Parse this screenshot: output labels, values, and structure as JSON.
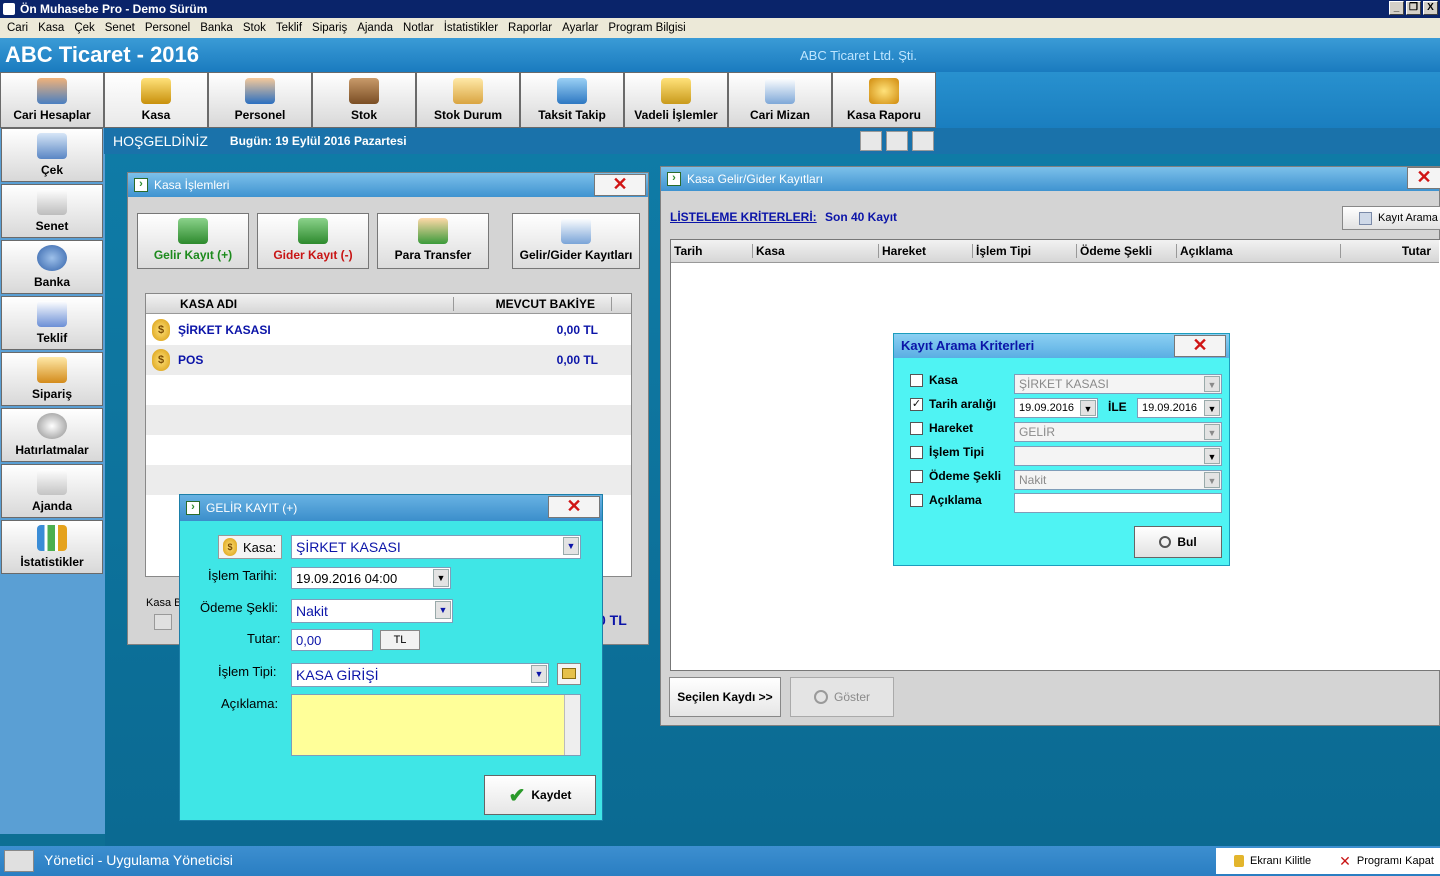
{
  "window": {
    "title": "Ön Muhasebe Pro - Demo Sürüm",
    "buttons": [
      "_",
      "❐",
      "X"
    ]
  },
  "menu": [
    "Cari",
    "Kasa",
    "Çek",
    "Senet",
    "Personel",
    "Banka",
    "Stok",
    "Teklif",
    "Sipariş",
    "Ajanda",
    "Notlar",
    "İstatistikler",
    "Raporlar",
    "Ayarlar",
    "Program Bilgisi"
  ],
  "header": {
    "title": "ABC Ticaret - 2016",
    "company": "ABC Ticaret Ltd. Şti."
  },
  "toolbar": [
    "Cari Hesaplar",
    "Kasa",
    "Personel",
    "Stok",
    "Stok Durum",
    "Taksit Takip",
    "Vadeli İşlemler",
    "Cari Mizan",
    "Kasa Raporu"
  ],
  "welcome": {
    "greeting": "HOŞGELDİNİZ",
    "date": "Bugün: 19 Eylül 2016 Pazartesi"
  },
  "sidebar": [
    "Çek",
    "Senet",
    "Banka",
    "Teklif",
    "Sipariş",
    "Hatırlatmalar",
    "Ajanda",
    "İstatistikler"
  ],
  "kasa_islemleri": {
    "title": "Kasa İşlemleri",
    "buttons": {
      "gelir": "Gelir Kayıt (+)",
      "gider": "Gider Kayıt (-)",
      "transfer": "Para Transfer",
      "kayitlar": "Gelir/Gider Kayıtları"
    },
    "columns": {
      "name": "KASA ADI",
      "balance": "MEVCUT BAKİYE"
    },
    "rows": [
      {
        "name": "ŞİRKET KASASI",
        "balance": "0,00 TL"
      },
      {
        "name": "POS",
        "balance": "0,00 TL"
      }
    ],
    "footer_label": "Kasa B",
    "footer_value": "0 TL"
  },
  "gelir_kayit": {
    "title": "GELİR KAYIT (+)",
    "kasa_label": "Kasa:",
    "kasa_value": "ŞİRKET KASASI",
    "tarih_label": "İşlem Tarihi:",
    "tarih_value": "19.09.2016 04:00",
    "odeme_label": "Ödeme Şekli:",
    "odeme_value": "Nakit",
    "tutar_label": "Tutar:",
    "tutar_value": "0,00",
    "currency": "TL",
    "tip_label": "İşlem Tipi:",
    "tip_value": "KASA GİRİŞİ",
    "aciklama_label": "Açıklama:",
    "save": "Kaydet"
  },
  "kayitlar": {
    "title": "Kasa Gelir/Gider Kayıtları",
    "criteria_link": "LİSTELEME KRİTERLERİ:",
    "criteria_value": "Son 40 Kayıt",
    "search_button": "Kayıt Arama",
    "columns": [
      "Tarih",
      "Kasa",
      "Hareket",
      "İşlem Tipi",
      "Ödeme Şekli",
      "Açıklama",
      "Tutar"
    ],
    "selected_button": "Seçilen Kaydı >>",
    "show_button": "Göster"
  },
  "arama": {
    "title": "Kayıt Arama Kriterleri",
    "kasa_label": "Kasa",
    "kasa_value": "ŞİRKET KASASI",
    "tarih_label": "Tarih aralığı",
    "tarih_from": "19.09.2016",
    "ile": "İLE",
    "tarih_to": "19.09.2016",
    "hareket_label": "Hareket",
    "hareket_value": "GELİR",
    "tip_label": "İşlem Tipi",
    "odeme_label": "Ödeme Şekli",
    "odeme_value": "Nakit",
    "aciklama_label": "Açıklama",
    "find": "Bul"
  },
  "status": {
    "user": "Yönetici - Uygulama Yöneticisi",
    "lock": "Ekranı Kilitle",
    "close": "Programı Kapat"
  }
}
